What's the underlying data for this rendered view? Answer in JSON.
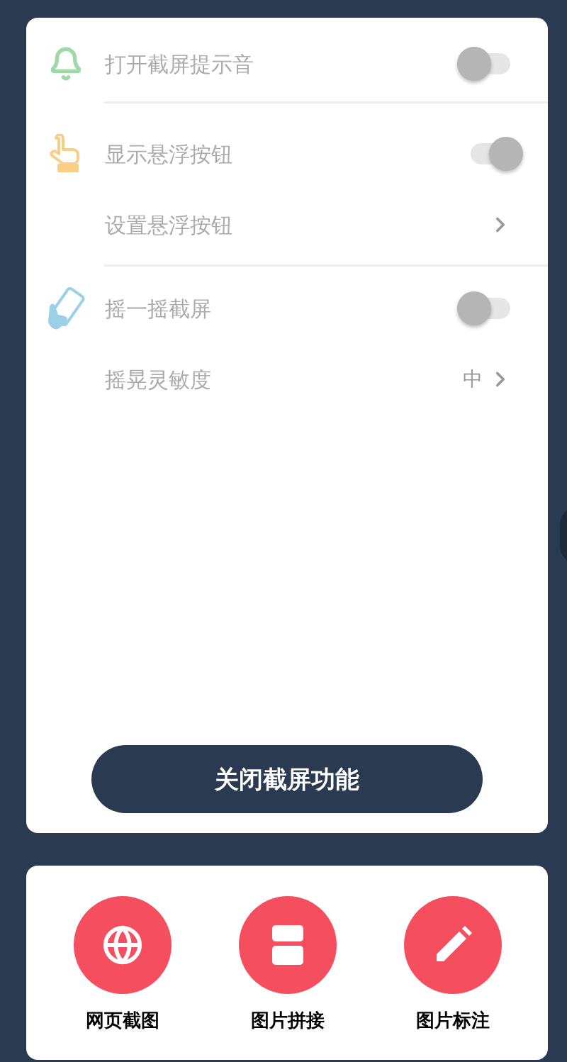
{
  "sections": [
    {
      "items": [
        {
          "kind": "toggle",
          "label": "打开截屏提示音",
          "on": false
        }
      ]
    },
    {
      "items": [
        {
          "kind": "toggle",
          "label": "显示悬浮按钮",
          "on": true
        },
        {
          "kind": "link",
          "label": "设置悬浮按钮"
        }
      ]
    },
    {
      "items": [
        {
          "kind": "toggle",
          "label": "摇一摇截屏",
          "on": false
        },
        {
          "kind": "link",
          "label": "摇晃灵敏度",
          "value": "中"
        }
      ]
    }
  ],
  "primary_button": "关闭截屏功能",
  "tools": [
    {
      "label": "网页截图"
    },
    {
      "label": "图片拼接"
    },
    {
      "label": "图片标注"
    }
  ]
}
